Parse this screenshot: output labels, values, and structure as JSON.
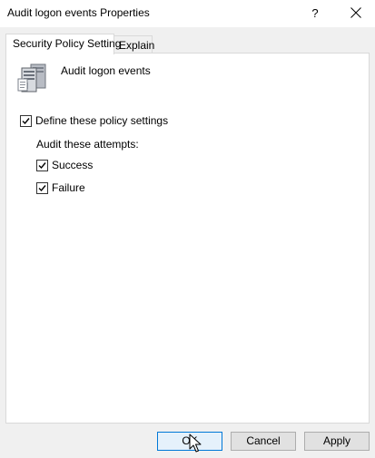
{
  "window": {
    "title": "Audit logon events Properties",
    "help_glyph": "?"
  },
  "tabs": [
    {
      "label": "Security Policy Setting",
      "active": true
    },
    {
      "label": "Explain",
      "active": false
    }
  ],
  "policy": {
    "name": "Audit logon events",
    "icon": "server-policy-icon"
  },
  "settings": {
    "define_label": "Define these policy settings",
    "define_checked": true,
    "audit_label": "Audit these attempts:",
    "success_label": "Success",
    "success_checked": true,
    "failure_label": "Failure",
    "failure_checked": true
  },
  "buttons": {
    "ok": "OK",
    "cancel": "Cancel",
    "apply": "Apply"
  }
}
